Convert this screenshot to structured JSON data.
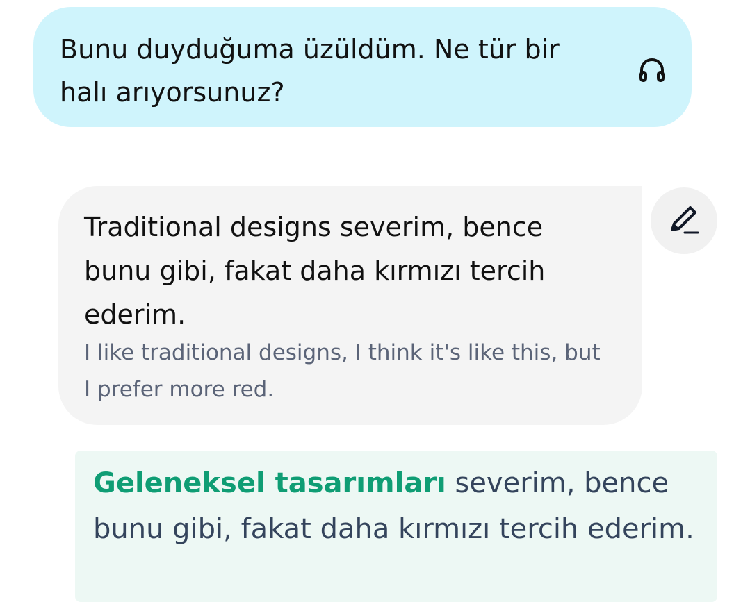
{
  "bot_message": {
    "text": "Bunu duyduğuma üzüldüm. Ne tür bir halı arıyorsunuz?",
    "listen_icon": "headphones-icon"
  },
  "user_message": {
    "text": "Traditional designs severim, bence bunu gibi, fakat daha kırmızı tercih ederim.",
    "translation": "I like traditional designs, I think it's like this, but I prefer more red.",
    "edit_icon": "pencil-icon"
  },
  "correction": {
    "highlight": "Geleneksel tasarımları",
    "rest": " severim, bence bunu gibi, fakat daha kırmızı tercih ederim."
  },
  "colors": {
    "bot_bubble": "#cff4fc",
    "user_bubble": "#f4f4f4",
    "correction_bg": "#edf8f4",
    "highlight": "#0f9d74",
    "translation_text": "#5b6478"
  }
}
